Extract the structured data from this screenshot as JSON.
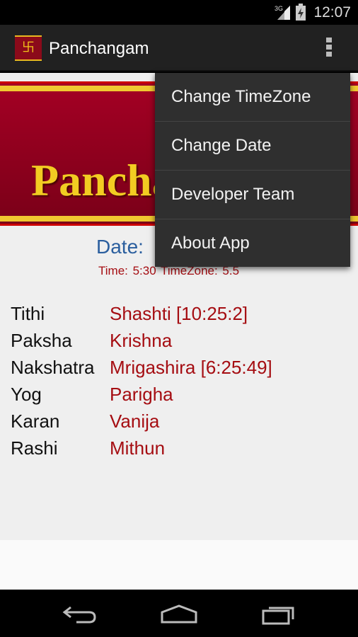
{
  "status_bar": {
    "network": "3G",
    "time": "12:07"
  },
  "action_bar": {
    "title": "Panchangam",
    "logo_icon": "swastik-logo",
    "logo_text": "Panchangam"
  },
  "banner": {
    "text": "Panchangam"
  },
  "main": {
    "date_label": "Date: ",
    "time_line": "Time: 5:30  TimeZone: 5.5",
    "rows": [
      {
        "label": "Tithi",
        "value": "Shashti  [10:25:2]"
      },
      {
        "label": "Paksha",
        "value": "Krishna"
      },
      {
        "label": "Nakshatra",
        "value": "Mrigashira  [6:25:49]"
      },
      {
        "label": "Yog",
        "value": "Parigha"
      },
      {
        "label": "Karan",
        "value": "Vanija"
      },
      {
        "label": "Rashi",
        "value": "Mithun"
      }
    ]
  },
  "menu": {
    "items": [
      {
        "label": "Change TimeZone"
      },
      {
        "label": "Change Date"
      },
      {
        "label": "Developer Team"
      },
      {
        "label": "About App"
      }
    ]
  },
  "colors": {
    "accent_red": "#a50d12",
    "date_blue": "#2a5e9e",
    "banner_gold": "#f2cc22"
  }
}
